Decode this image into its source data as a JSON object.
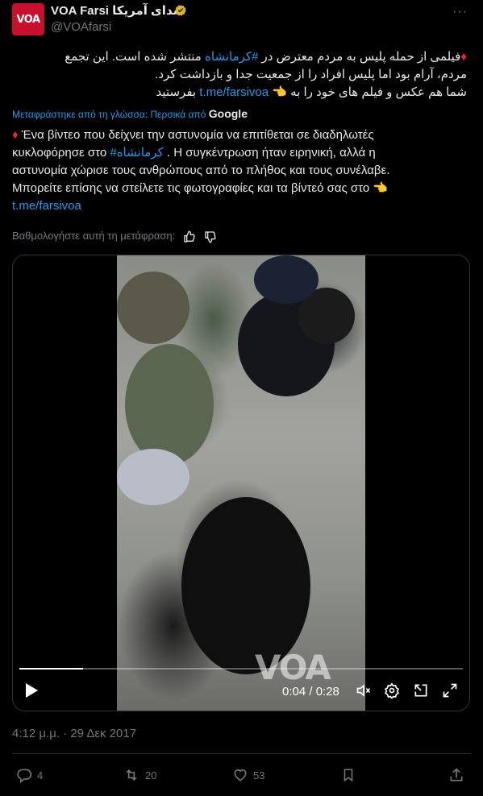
{
  "account": {
    "name": "VOA Farsi صدای آمریکا",
    "handle": "@VOAfarsi",
    "avatar_text": "VOA",
    "verified": true,
    "more": "···"
  },
  "tweet": {
    "original_lines": {
      "line1_prefix": "فیلمی از حمله پلیس به مردم معترض در ",
      "line1_hashtag": "#کرمانشاه",
      "line1_suffix": " منتشر شده است. این تجمع",
      "line2": "مردم، آرام بود اما پلیس افراد را از جمعیت جدا و بازداشت کرد.",
      "line3_prefix": "شما هم عکس و فیلم های خود را به ",
      "line3_emoji": "👈",
      "line3_link": "t.me/farsivoa",
      "line3_suffix": " بفرستید"
    },
    "translated_from": "Μεταφράστηκε από τη γλώσσα: Περσικά από",
    "translated_by": "Google",
    "greek_lines": {
      "line1": " Ένα βίντεο που δείχνει την αστυνομία να επιτίθεται σε διαδηλωτές",
      "line2_prefix": "κυκλοφόρησε στο ",
      "line2_hashtag": "#کرمانشاه",
      "line2_suffix": " . Η συγκέντρωση ήταν ειρηνική, αλλά η",
      "line3": "αστυνομία χώρισε τους ανθρώπους από το πλήθος και τους συνέλαβε.",
      "line4": "Μπορείτε επίσης να στείλετε τις φωτογραφίες και τα βίντεό σας στο ",
      "line4_emoji": "👈",
      "line5_link": "t.me/farsivoa"
    },
    "rate_translation": "Βαθμολογήστε αυτή τη μετάφραση:"
  },
  "video": {
    "time": "0:04 / 0:28",
    "progress": 0.143,
    "watermark": "VOA"
  },
  "meta": {
    "timestamp": "4:12 μ.μ. · 29 Δεκ 2017"
  },
  "actions": {
    "replies": "4",
    "reposts": "20",
    "likes": "53"
  },
  "colors": {
    "background": "#000000",
    "link": "#1d9bf0",
    "muted": "#71767b",
    "diamond": "#f4212e"
  }
}
